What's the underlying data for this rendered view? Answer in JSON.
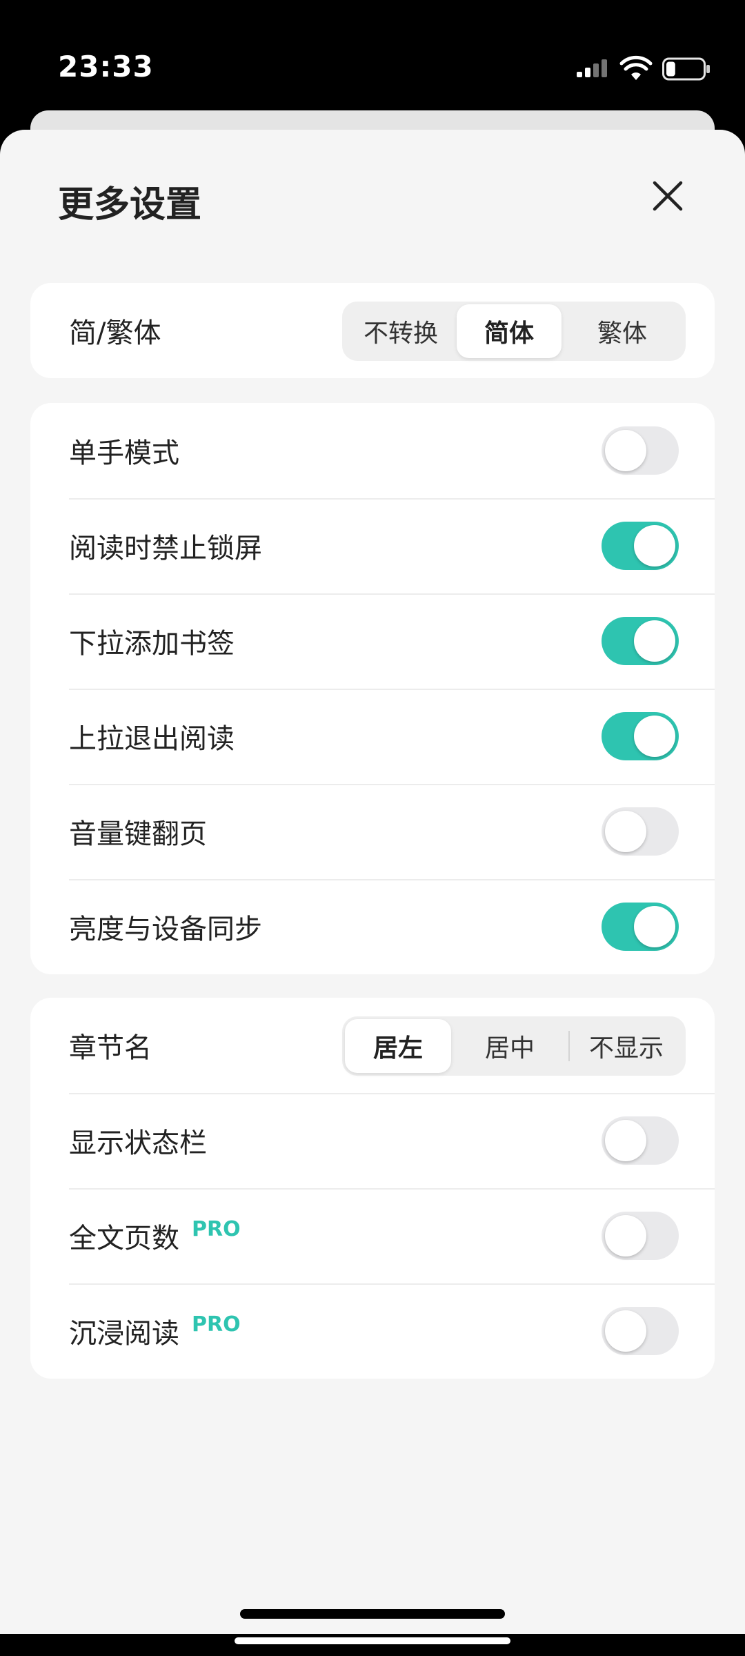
{
  "status_bar": {
    "time": "23:33",
    "icons": [
      "signal-icon",
      "wifi-icon",
      "battery-icon"
    ],
    "battery_level": 0.25
  },
  "sheet": {
    "title": "更多设置",
    "close_icon": "close-icon"
  },
  "conversion": {
    "label": "简/繁体",
    "options": [
      "不转换",
      "简体",
      "繁体"
    ],
    "selected": "简体"
  },
  "toggles": [
    {
      "label": "单手模式",
      "on": false
    },
    {
      "label": "阅读时禁止锁屏",
      "on": true
    },
    {
      "label": "下拉添加书签",
      "on": true
    },
    {
      "label": "上拉退出阅读",
      "on": true
    },
    {
      "label": "音量键翻页",
      "on": false
    },
    {
      "label": "亮度与设备同步",
      "on": true
    }
  ],
  "chapter_name": {
    "label": "章节名",
    "options": [
      "居左",
      "居中",
      "不显示"
    ],
    "selected": "居左"
  },
  "display_toggles": [
    {
      "label": "显示状态栏",
      "on": false,
      "badge": ""
    },
    {
      "label": "全文页数",
      "on": false,
      "badge": "PRO"
    },
    {
      "label": "沉浸阅读",
      "on": false,
      "badge": "PRO"
    }
  ],
  "colors": {
    "accent": "#2ec4b0",
    "toggle_off": "#e9e9eb",
    "sheet_bg": "#f5f5f5",
    "card_bg": "#ffffff"
  }
}
